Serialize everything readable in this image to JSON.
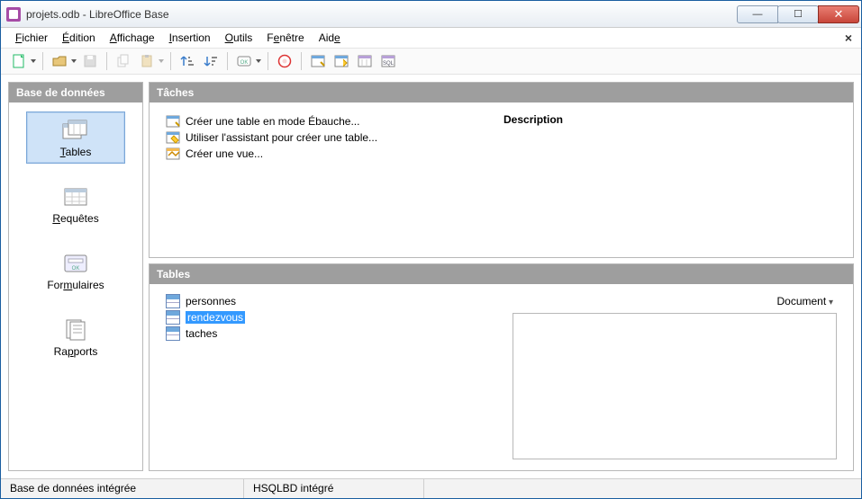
{
  "window": {
    "title": "projets.odb - LibreOffice Base"
  },
  "menu": {
    "items": [
      {
        "pre": "",
        "ul": "F",
        "post": "ichier"
      },
      {
        "pre": "",
        "ul": "É",
        "post": "dition"
      },
      {
        "pre": "",
        "ul": "A",
        "post": "ffichage"
      },
      {
        "pre": "",
        "ul": "I",
        "post": "nsertion"
      },
      {
        "pre": "",
        "ul": "O",
        "post": "utils"
      },
      {
        "pre": "F",
        "ul": "e",
        "post": "nêtre"
      },
      {
        "pre": "Aid",
        "ul": "e",
        "post": ""
      }
    ]
  },
  "sidebar": {
    "title": "Base de données",
    "items": [
      {
        "ul": "T",
        "label": "ables",
        "selected": true,
        "icon": "tables"
      },
      {
        "ul": "R",
        "label": "equêtes",
        "selected": false,
        "icon": "queries"
      },
      {
        "pre": "For",
        "ul": "m",
        "label": "ulaires",
        "selected": false,
        "icon": "forms"
      },
      {
        "pre": "Ra",
        "ul": "p",
        "label": "ports",
        "selected": false,
        "icon": "reports"
      }
    ]
  },
  "tasks": {
    "title": "Tâches",
    "items": [
      "Créer une table en mode Ébauche...",
      "Utiliser l'assistant pour créer une table...",
      "Créer une vue..."
    ],
    "description_label": "Description"
  },
  "tables": {
    "title": "Tables",
    "items": [
      {
        "name": "personnes",
        "selected": false
      },
      {
        "name": "rendezvous",
        "selected": true
      },
      {
        "name": "taches",
        "selected": false
      }
    ],
    "preview_mode": "Document"
  },
  "status": {
    "left": "Base de données intégrée",
    "mid": "HSQLBD intégré"
  }
}
